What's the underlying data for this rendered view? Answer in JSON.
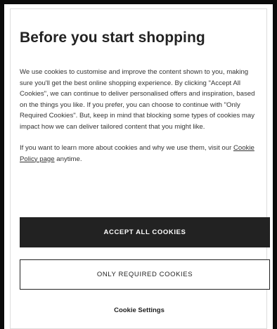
{
  "dialog": {
    "title": "Before you start shopping",
    "paragraph1": "We use cookies to customise and improve the content shown to you, making sure you'll get the best online shopping experience. By clicking \"Accept All Cookies\", we can continue to deliver personalised offers and inspiration, based on the things you like. If you prefer, you can choose to continue with \"Only Required Cookies\". But, keep in mind that blocking some types of cookies may impact how we can deliver tailored content that you might like.",
    "paragraph2_before": "If you want to learn more about cookies and why we use them, visit our ",
    "paragraph2_link": "Cookie Policy page",
    "paragraph2_after": " anytime.",
    "accept_all_label": "ACCEPT ALL COOKIES",
    "only_required_label": "ONLY REQUIRED COOKIES",
    "settings_label": "Cookie Settings"
  }
}
